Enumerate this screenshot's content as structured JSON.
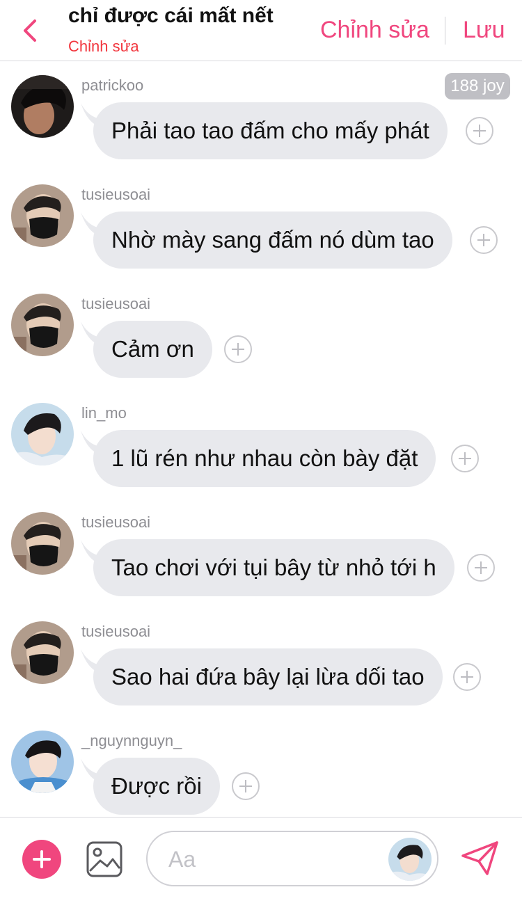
{
  "header": {
    "title": "chỉ được cái mất nết",
    "subtitle": "Chỉnh sửa",
    "edit_label": "Chỉnh sửa",
    "save_label": "Lưu"
  },
  "accent_color": "#f0467e",
  "messages": [
    {
      "user": "patrickoo",
      "text": "Phải tao tao đấm cho mấy phát",
      "avatar": "avatar-dark-hair"
    },
    {
      "user": "tusieusoai",
      "text": "Nhờ mày sang đấm nó dùm tao",
      "avatar": "avatar-black-mask"
    },
    {
      "user": "tusieusoai",
      "text": "Cảm ơn",
      "avatar": "avatar-black-mask"
    },
    {
      "user": "lin_mo",
      "text": "1 lũ rén như nhau còn bày đặt",
      "avatar": "avatar-light-blue"
    },
    {
      "user": "tusieusoai",
      "text": "Tao chơi với tụi bây từ nhỏ tới h",
      "avatar": "avatar-black-mask"
    },
    {
      "user": "tusieusoai",
      "text": "Sao hai đứa bây lại lừa dối tao",
      "avatar": "avatar-black-mask"
    },
    {
      "user": "_nguynnguyn_",
      "text": "Được rồi",
      "avatar": "avatar-blue-shirt"
    }
  ],
  "joy_badge": "188 joy",
  "composer": {
    "placeholder": "Aa",
    "add_icon": "plus-circle-icon",
    "image_icon": "image-icon",
    "send_icon": "send-icon"
  }
}
